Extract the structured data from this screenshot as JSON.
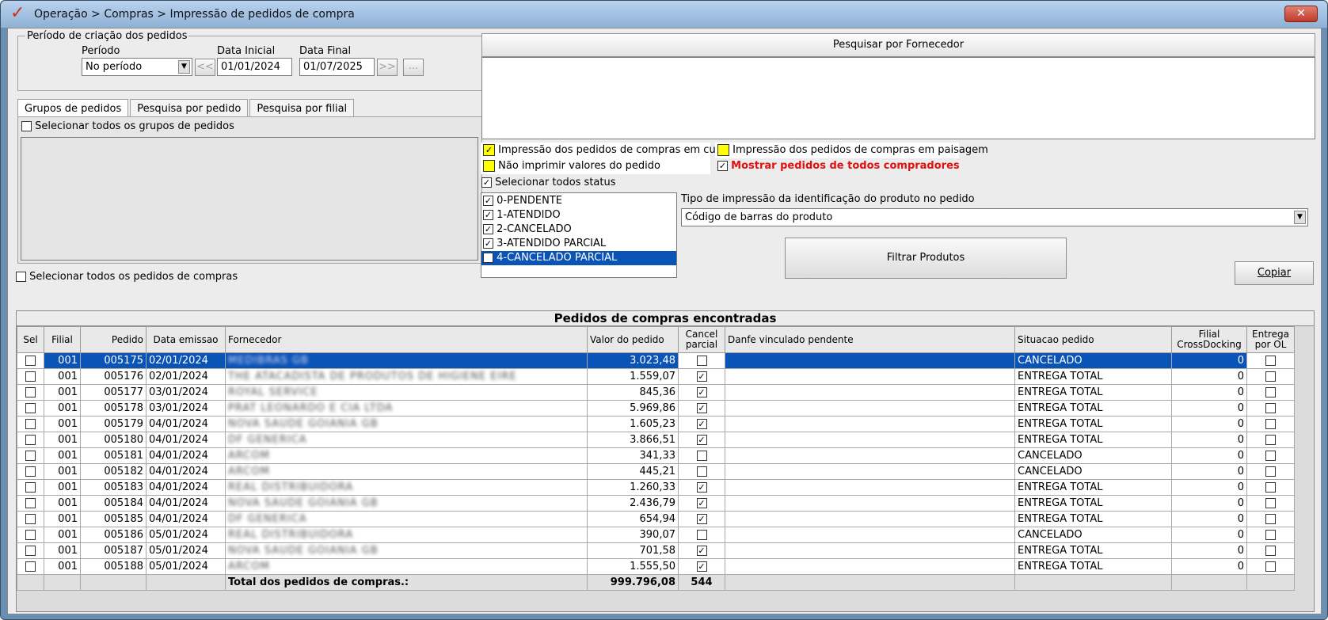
{
  "window": {
    "title": "Operação > Compras > Impressão de pedidos de compra",
    "close": "✕"
  },
  "periodo": {
    "group_label": "Período de criação dos pedidos",
    "periodo_label": "Período",
    "periodo_value": "No período",
    "data_inicial_label": "Data Inicial",
    "data_inicial_value": "01/01/2024",
    "data_final_label": "Data Final",
    "data_final_value": "01/07/2025",
    "prev_label": "<<",
    "next_label": ">>",
    "more_label": "..."
  },
  "tabs": [
    "Grupos de pedidos",
    "Pesquisa por pedido",
    "Pesquisa por filial"
  ],
  "grupos": {
    "select_all_label": "Selecionar todos os grupos de pedidos"
  },
  "select_all_pedidos_label": "Selecionar todos os pedidos de compras",
  "fornecedor": {
    "header": "Pesquisar por Fornecedor"
  },
  "options": {
    "cubo": "Impressão dos pedidos de compras em cubo",
    "paisagem": "Impressão dos pedidos de compras em paisagem",
    "nao_imprimir": "Não imprimir valores do pedido",
    "mostrar_todos": "Mostrar pedidos de todos compradores",
    "select_all_status": "Selecionar todos status"
  },
  "status_list": [
    "0-PENDENTE",
    "1-ATENDIDO",
    "2-CANCELADO",
    "3-ATENDIDO PARCIAL",
    "4-CANCELADO PARCIAL"
  ],
  "tipo_impressao": {
    "label": "Tipo de impressão da identificação do produto no pedido",
    "value": "Código de barras do produto"
  },
  "buttons": {
    "filtrar": "Filtrar Produtos",
    "copiar": "Copiar"
  },
  "grid": {
    "title": "Pedidos de compras encontradas",
    "headers": {
      "sel": "Sel",
      "filial": "Filial",
      "pedido": "Pedido",
      "data": "Data emissao",
      "fornecedor": "Fornecedor",
      "valor": "Valor do pedido",
      "cancel1": "Cancel",
      "cancel2": "parcial",
      "danfe": "Danfe vinculado pendente",
      "situacao": "Situacao pedido",
      "fcd1": "Filial",
      "fcd2": "CrossDocking",
      "ent1": "Entrega",
      "ent2": "por OL"
    },
    "rows": [
      {
        "filial": "001",
        "pedido": "005175",
        "data": "02/01/2024",
        "fornecedor": "MEDIBRAS GB",
        "valor": "3.023,48",
        "cancel": false,
        "situacao": "CANCELADO",
        "fcd": "0"
      },
      {
        "filial": "001",
        "pedido": "005176",
        "data": "02/01/2024",
        "fornecedor": "THE ATACADISTA DE PRODUTOS DE HIGIENE EIRE",
        "valor": "1.559,07",
        "cancel": true,
        "situacao": "ENTREGA TOTAL",
        "fcd": "0"
      },
      {
        "filial": "001",
        "pedido": "005177",
        "data": "03/01/2024",
        "fornecedor": "ROYAL SERVICE",
        "valor": "845,36",
        "cancel": true,
        "situacao": "ENTREGA TOTAL",
        "fcd": "0"
      },
      {
        "filial": "001",
        "pedido": "005178",
        "data": "03/01/2024",
        "fornecedor": "PRAT LEONARDO E CIA LTDA",
        "valor": "5.969,86",
        "cancel": true,
        "situacao": "ENTREGA TOTAL",
        "fcd": "0"
      },
      {
        "filial": "001",
        "pedido": "005179",
        "data": "04/01/2024",
        "fornecedor": "NOVA SAUDE GOIANIA GB",
        "valor": "1.605,23",
        "cancel": true,
        "situacao": "ENTREGA TOTAL",
        "fcd": "0"
      },
      {
        "filial": "001",
        "pedido": "005180",
        "data": "04/01/2024",
        "fornecedor": "DF GENERICA",
        "valor": "3.866,51",
        "cancel": true,
        "situacao": "ENTREGA TOTAL",
        "fcd": "0"
      },
      {
        "filial": "001",
        "pedido": "005181",
        "data": "04/01/2024",
        "fornecedor": "ARCOM",
        "valor": "341,33",
        "cancel": false,
        "situacao": "CANCELADO",
        "fcd": "0"
      },
      {
        "filial": "001",
        "pedido": "005182",
        "data": "04/01/2024",
        "fornecedor": "ARCOM",
        "valor": "445,21",
        "cancel": false,
        "situacao": "CANCELADO",
        "fcd": "0"
      },
      {
        "filial": "001",
        "pedido": "005183",
        "data": "04/01/2024",
        "fornecedor": "REAL DISTRIBUIDORA",
        "valor": "1.260,33",
        "cancel": true,
        "situacao": "ENTREGA TOTAL",
        "fcd": "0"
      },
      {
        "filial": "001",
        "pedido": "005184",
        "data": "04/01/2024",
        "fornecedor": "NOVA SAUDE GOIANIA GB",
        "valor": "2.436,79",
        "cancel": true,
        "situacao": "ENTREGA TOTAL",
        "fcd": "0"
      },
      {
        "filial": "001",
        "pedido": "005185",
        "data": "04/01/2024",
        "fornecedor": "DF GENERICA",
        "valor": "654,94",
        "cancel": true,
        "situacao": "ENTREGA TOTAL",
        "fcd": "0"
      },
      {
        "filial": "001",
        "pedido": "005186",
        "data": "05/01/2024",
        "fornecedor": "REAL DISTRIBUIDORA",
        "valor": "390,07",
        "cancel": false,
        "situacao": "CANCELADO",
        "fcd": "0"
      },
      {
        "filial": "001",
        "pedido": "005187",
        "data": "05/01/2024",
        "fornecedor": "NOVA SAUDE GOIANIA GB",
        "valor": "701,58",
        "cancel": true,
        "situacao": "ENTREGA TOTAL",
        "fcd": "0"
      },
      {
        "filial": "001",
        "pedido": "005188",
        "data": "05/01/2024",
        "fornecedor": "ARCOM",
        "valor": "1.555,50",
        "cancel": true,
        "situacao": "ENTREGA TOTAL",
        "fcd": "0"
      }
    ],
    "total_label": "Total dos pedidos de compras.:",
    "total_valor": "999.796,08",
    "total_count": "544"
  }
}
